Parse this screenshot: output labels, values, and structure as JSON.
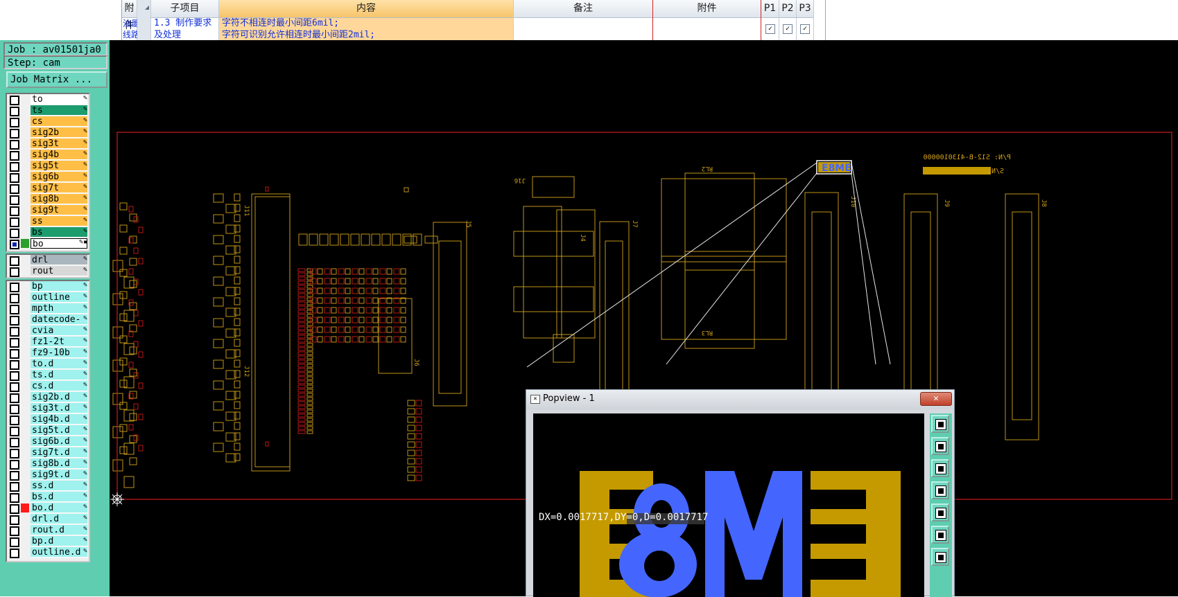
{
  "sheet": {
    "headers": [
      "附件",
      "子项目",
      "内容",
      "备注",
      "附件",
      "P1",
      "P2",
      "P3"
    ],
    "row_left": [
      "油墨",
      "线路"
    ],
    "row_item": [
      "1.3 制作要求",
      "及处理"
    ],
    "row_content": [
      "字符不相连时最小间距6mil;",
      "字符可识别允许相连时最小间距2mil;"
    ],
    "checks": [
      "✓",
      "✓",
      "✓"
    ]
  },
  "panel": {
    "job": "Job : av01501ja0",
    "step": "Step: cam",
    "job_matrix": "Job Matrix ...",
    "board_layers": [
      {
        "name": "to",
        "color": "white"
      },
      {
        "name": "ts",
        "color": "teal"
      },
      {
        "name": "cs",
        "color": "orange"
      },
      {
        "name": "sig2b",
        "color": "orange"
      },
      {
        "name": "sig3t",
        "color": "orange"
      },
      {
        "name": "sig4b",
        "color": "orange"
      },
      {
        "name": "sig5t",
        "color": "orange"
      },
      {
        "name": "sig6b",
        "color": "orange"
      },
      {
        "name": "sig7t",
        "color": "orange"
      },
      {
        "name": "sig8b",
        "color": "orange"
      },
      {
        "name": "sig9t",
        "color": "orange"
      },
      {
        "name": "ss",
        "color": "orange"
      },
      {
        "name": "bs",
        "color": "teal"
      },
      {
        "name": "bo",
        "color": "sel"
      }
    ],
    "drill_layers": [
      {
        "name": "drl",
        "color": "gray"
      },
      {
        "name": "rout",
        "color": "lgray"
      }
    ],
    "misc_layers": [
      {
        "name": "bp"
      },
      {
        "name": "outline"
      },
      {
        "name": "mpth"
      },
      {
        "name": "datecode-bs"
      },
      {
        "name": "cvia"
      },
      {
        "name": "fz1-2t"
      },
      {
        "name": "fz9-10b"
      },
      {
        "name": "to.d"
      },
      {
        "name": "ts.d"
      },
      {
        "name": "cs.d"
      },
      {
        "name": "sig2b.d"
      },
      {
        "name": "sig3t.d"
      },
      {
        "name": "sig4b.d"
      },
      {
        "name": "sig5t.d"
      },
      {
        "name": "sig6b.d"
      },
      {
        "name": "sig7t.d"
      },
      {
        "name": "sig8b.d"
      },
      {
        "name": "sig9t.d"
      },
      {
        "name": "ss.d"
      },
      {
        "name": "bs.d"
      },
      {
        "name": "bo.d"
      },
      {
        "name": "drl.d"
      },
      {
        "name": "rout.d"
      },
      {
        "name": "bp.d"
      },
      {
        "name": "outline.d"
      }
    ]
  },
  "canvas": {
    "labels": [
      "J16",
      "RL2",
      "RL3",
      "J10",
      "J9",
      "J8",
      "J5",
      "J7",
      "J4",
      "J12",
      "J11",
      "J6"
    ],
    "pn_text": "P/N: S12-B-4130100000",
    "sn_text": "S/N:",
    "logo_text": "E8ME"
  },
  "popview": {
    "title": "Popview - 1",
    "close": "✕",
    "logo_text": "E8ME",
    "measure": "DX=0.0017717,DY=0,D=0.0017717"
  },
  "colors": {
    "board": "#d4a31a",
    "outline": "#cc1b1b",
    "logo_blue": "#4466ff",
    "logo_gold": "#c49a00",
    "panel": "#5ecdb0"
  },
  "icons": [
    "zoom-fit-icon",
    "pan-up-icon",
    "pan-down-icon",
    "pan-left-icon",
    "pan-right-icon",
    "zoom-in-icon",
    "zoom-out-icon"
  ]
}
